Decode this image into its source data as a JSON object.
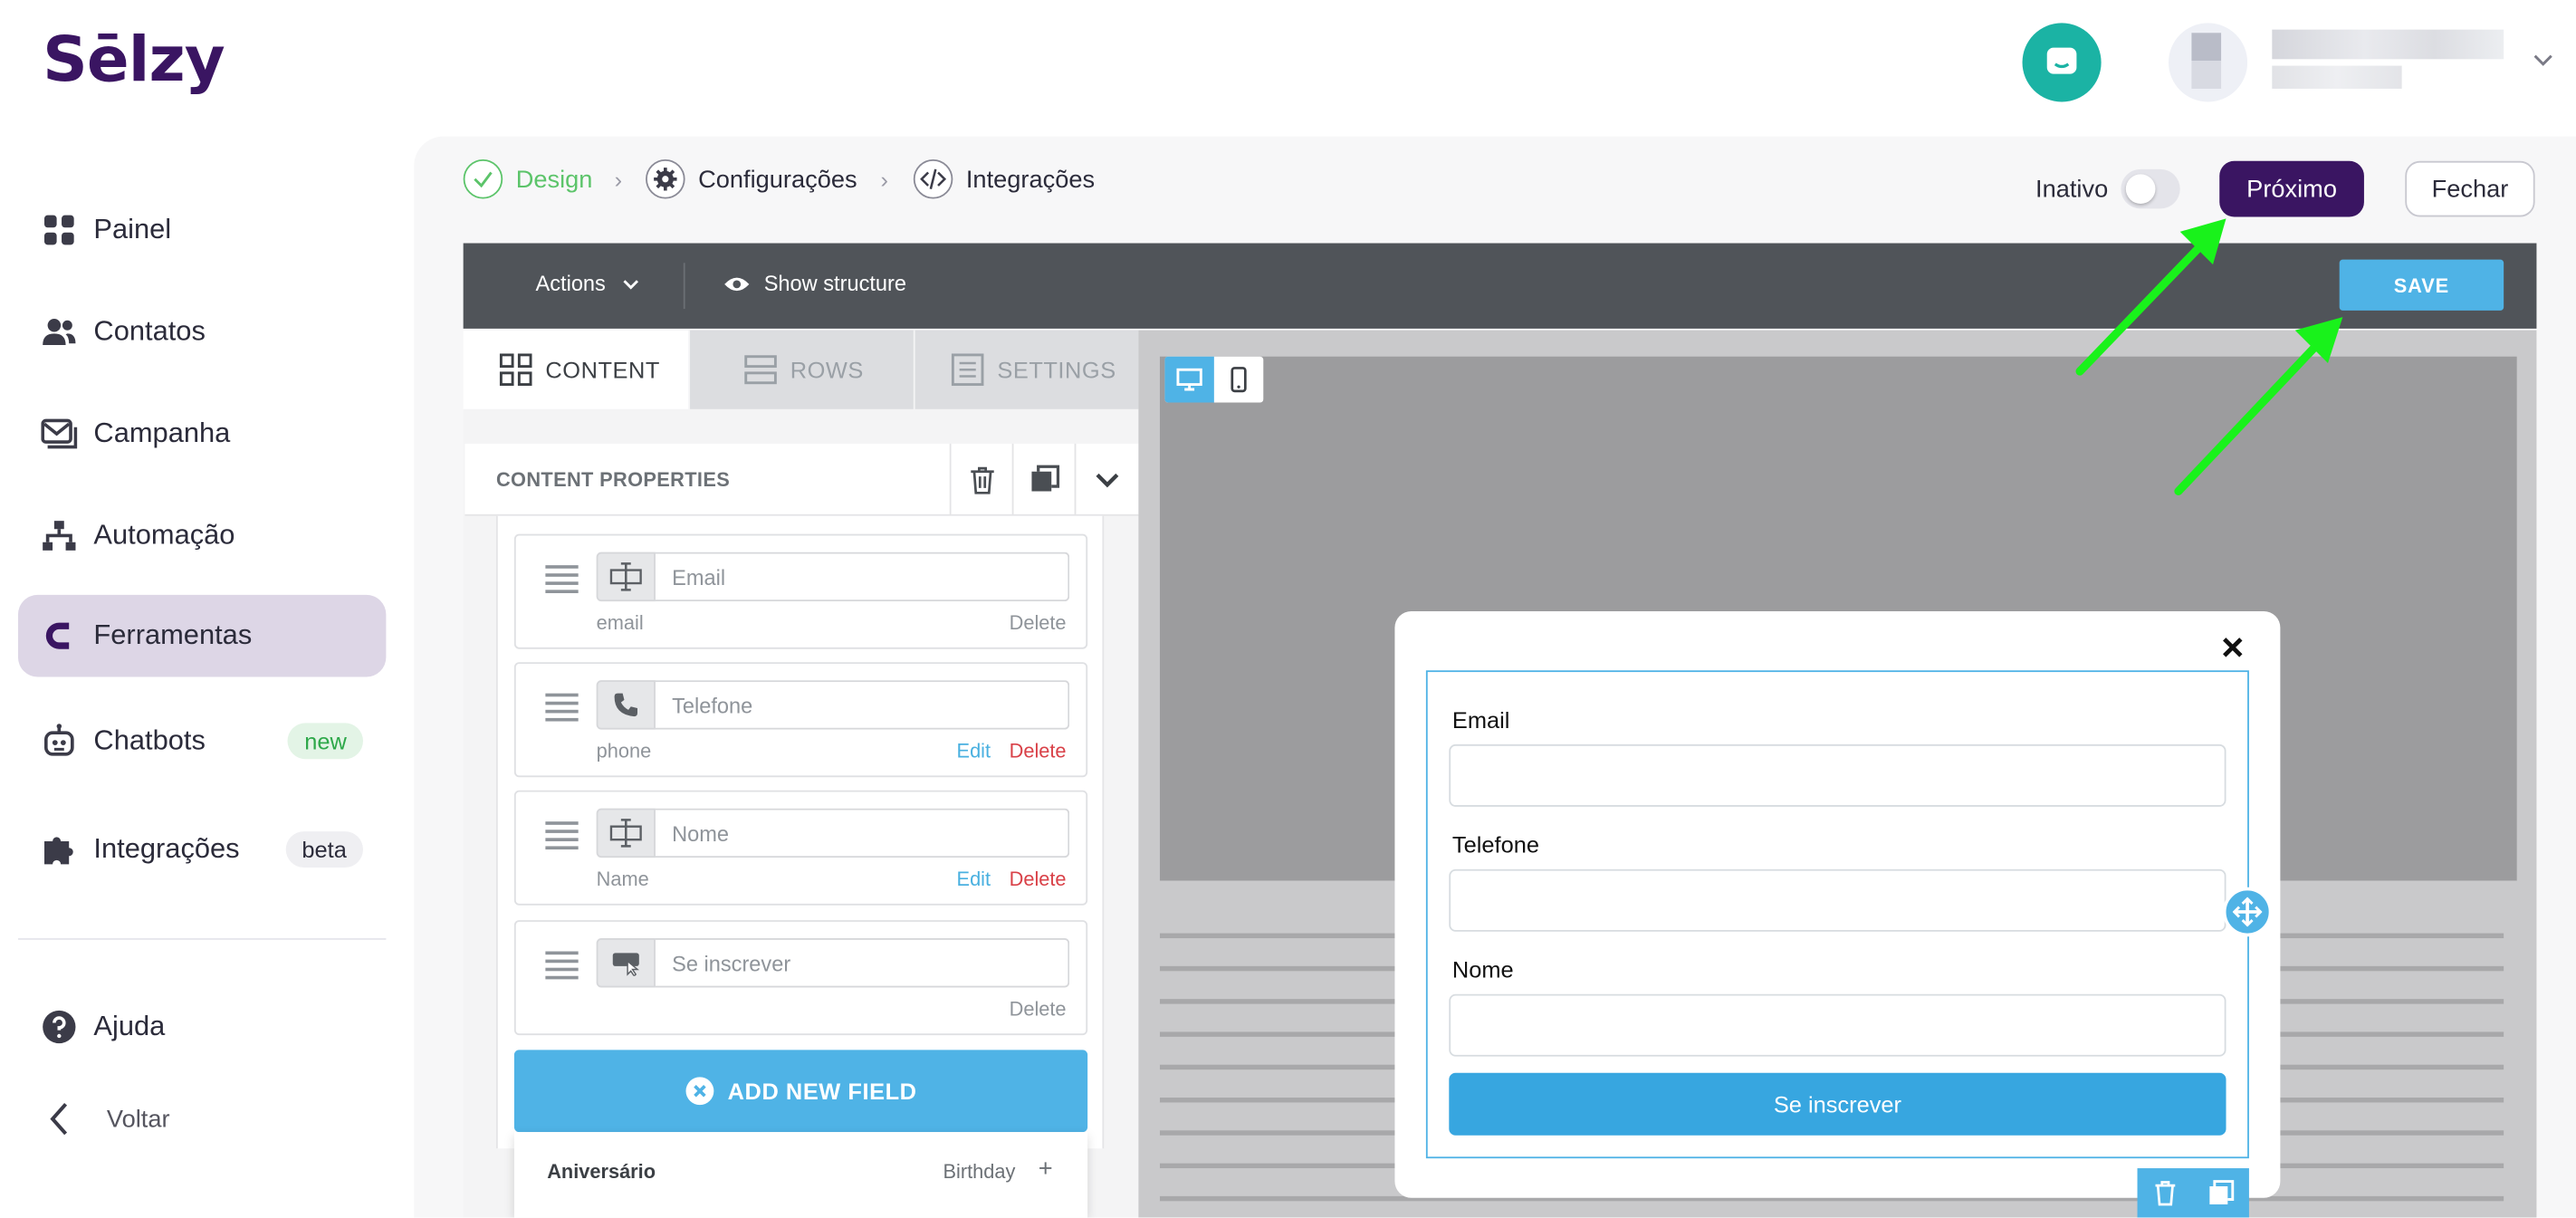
{
  "brand": {
    "logo": "Sēlzy",
    "accent": "#3a1562",
    "highlight": "#4fb3e6",
    "annotation_color": "#19f21b"
  },
  "header": {
    "chat_icon": "chat-bubble-icon",
    "user_menu_icon": "chevron-down-icon"
  },
  "sidebar": {
    "items": [
      {
        "label": "Painel",
        "icon": "grid-icon"
      },
      {
        "label": "Contatos",
        "icon": "users-icon"
      },
      {
        "label": "Campanha",
        "icon": "mail-icon"
      },
      {
        "label": "Automação",
        "icon": "sitemap-icon"
      },
      {
        "label": "Ferramentas",
        "icon": "magnet-icon",
        "active": true
      },
      {
        "label": "Chatbots",
        "icon": "robot-icon",
        "badge": "new"
      },
      {
        "label": "Integrações",
        "icon": "puzzle-icon",
        "badge": "beta"
      }
    ],
    "help": "Ajuda",
    "back": "Voltar"
  },
  "steps": [
    {
      "label": "Design",
      "state": "done"
    },
    {
      "label": "Configurações",
      "state": "pending"
    },
    {
      "label": "Integrações",
      "state": "pending"
    }
  ],
  "status": {
    "label": "Inativo",
    "enabled": false
  },
  "buttons": {
    "next": "Próximo",
    "close": "Fechar"
  },
  "editor": {
    "actions": "Actions",
    "show_structure": "Show structure",
    "save": "SAVE",
    "tabs": [
      "CONTENT",
      "ROWS",
      "SETTINGS"
    ],
    "content_properties": "CONTENT PROPERTIES",
    "fields": [
      {
        "placeholder": "Email",
        "key": "email",
        "edit": "",
        "delete": "Delete",
        "icon": "text-field-icon"
      },
      {
        "placeholder": "Telefone",
        "key": "phone",
        "edit": "Edit",
        "delete": "Delete",
        "icon": "phone-icon"
      },
      {
        "placeholder": "Nome",
        "key": "Name",
        "edit": "Edit",
        "delete": "Delete",
        "icon": "text-field-icon"
      },
      {
        "placeholder": "Se inscrever",
        "key": "",
        "edit": "",
        "delete": "Delete",
        "icon": "submit-button-icon"
      }
    ],
    "add_field": "ADD NEW FIELD",
    "dropdown_item": {
      "label": "Aniversário",
      "type": "Birthday",
      "action": "+"
    }
  },
  "popup": {
    "labels": [
      "Email",
      "Telefone",
      "Nome"
    ],
    "submit": "Se inscrever"
  }
}
